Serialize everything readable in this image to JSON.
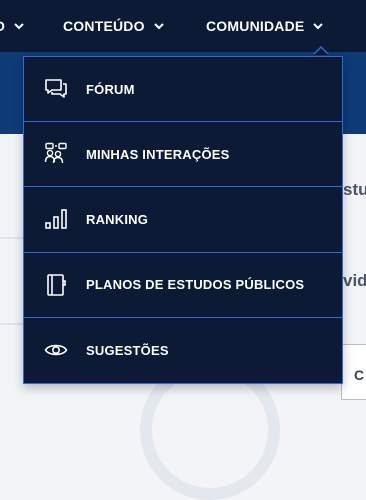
{
  "nav": {
    "partial_item": {
      "label": "O"
    },
    "content": {
      "label": "CONTEÚDO"
    },
    "community": {
      "label": "COMUNIDADE"
    }
  },
  "background": {
    "fragment_1": "stu",
    "fragment_2": "vida",
    "box_label": "C"
  },
  "dropdown": {
    "items": [
      {
        "label": "FÓRUM",
        "icon": "chat-bubbles-icon"
      },
      {
        "label": "MINHAS INTERAÇÕES",
        "icon": "people-interactions-icon"
      },
      {
        "label": "RANKING",
        "icon": "bar-chart-icon"
      },
      {
        "label": "PLANOS DE ESTUDOS PÚBLICOS",
        "icon": "notebook-icon"
      },
      {
        "label": "SUGESTÕES",
        "icon": "eye-icon"
      }
    ]
  },
  "colors": {
    "nav_bg": "#0c1a35",
    "accent_border": "#2d6cd8",
    "subbar": "#0f3b77",
    "text": "#ffffff"
  }
}
